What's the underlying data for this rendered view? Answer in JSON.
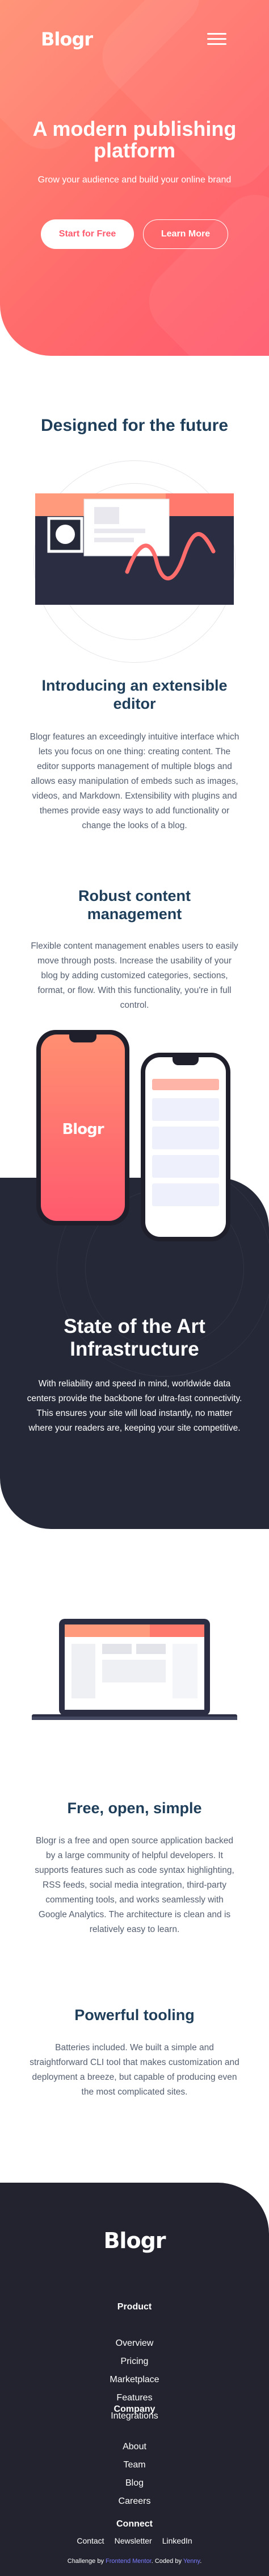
{
  "header": {
    "logo": "Blogr",
    "title": "A modern publishing platform",
    "subtitle": "Grow your audience and build your online brand",
    "start_label": "Start for Free",
    "more_label": "Learn More"
  },
  "future": {
    "title": "Designed for the future",
    "editor_title": "Introducing an extensible editor",
    "editor_text": "Blogr features an exceedingly intuitive interface which lets you focus on one thing: creating content. The editor supports management of multiple blogs and allows easy manipulation of embeds such as images, videos, and Markdown. Extensibility with plugins and themes provide easy ways to add functionality or change the looks of a blog.",
    "robust_title": "Robust content management",
    "robust_text": "Flexible content management enables users to easily move through posts. Increase the usability of your blog by adding customized categories, sections, format, or flow. With this functionality, you're in full control."
  },
  "phones": {
    "logo": "Blogr"
  },
  "infra": {
    "title": "State of the Art Infrastructure",
    "text": "With reliability and speed in mind, worldwide data centers provide the backbone for ultra-fast connectivity. This ensures your site will load instantly, no matter where your readers are, keeping your site competitive."
  },
  "simple": {
    "title": "Free, open, simple",
    "text": "Blogr is a free and open source application backed by a large community of helpful developers. It supports features such as code syntax highlighting, RSS feeds, social media integration, third-party commenting tools, and works seamlessly with Google Analytics. The architecture is clean and is relatively easy to learn.",
    "tooling_title": "Powerful tooling",
    "tooling_text": "Batteries included. We built a simple and straightforward CLI tool that makes customization and deployment a breeze, but capable of producing even the most complicated sites."
  },
  "footer": {
    "logo": "Blogr",
    "product_title": "Product",
    "product_links": [
      "Overview",
      "Pricing",
      "Marketplace",
      "Features",
      "Integrations"
    ],
    "company_title": "Company",
    "company_links": [
      "About",
      "Team",
      "Blog",
      "Careers"
    ],
    "connect_title": "Connect",
    "connect_links": [
      "Contact",
      "Newsletter",
      "LinkedIn"
    ],
    "attribution_prefix": "Challenge by",
    "attribution_fm": "Frontend Mentor",
    "attribution_mid": ". Coded by",
    "attribution_author": "Yenny",
    "attribution_end": "."
  },
  "colors": {
    "accent": "#ff6c6c",
    "hero_start": "#ff8f71",
    "hero_end": "#ff5a6e",
    "dark": "#252837",
    "heading": "#1f3e5a",
    "link": "#5f5fff"
  }
}
